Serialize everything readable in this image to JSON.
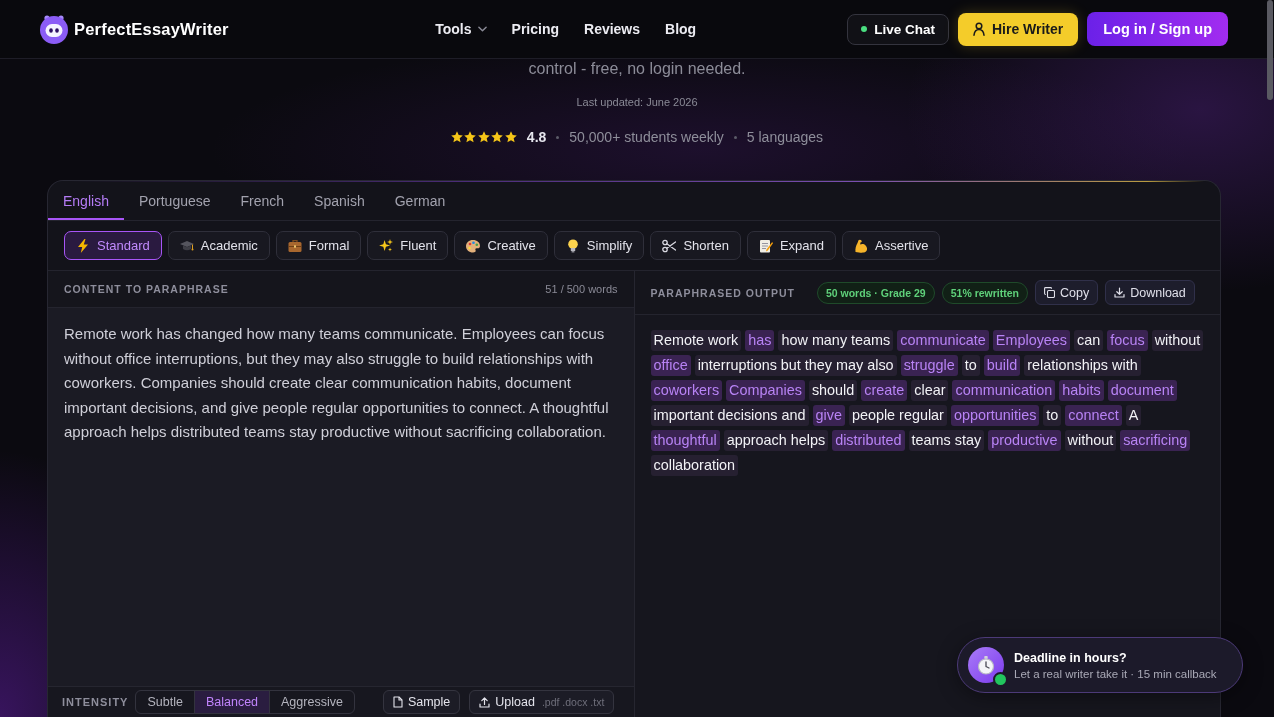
{
  "header": {
    "logo": "PerfectEssayWriter",
    "nav": [
      {
        "label": "Tools",
        "dropdown": true
      },
      {
        "label": "Pricing",
        "dropdown": false
      },
      {
        "label": "Reviews",
        "dropdown": false
      },
      {
        "label": "Blog",
        "dropdown": false
      }
    ],
    "live_chat": {
      "label": "Live Chat",
      "online": true
    },
    "hire_button": "Hire Writer",
    "login_button": "Log in / Sign up"
  },
  "hero": {
    "subtitle": "control - free, no login needed.",
    "updated": "Last updated: June 2026",
    "rating": {
      "stars": 5,
      "score": "4.8"
    },
    "facts": [
      "50,000+ students weekly",
      "5 languages"
    ]
  },
  "tool": {
    "languages": [
      {
        "label": "English",
        "selected": true
      },
      {
        "label": "Portuguese",
        "selected": false
      },
      {
        "label": "French",
        "selected": false
      },
      {
        "label": "Spanish",
        "selected": false
      },
      {
        "label": "German",
        "selected": false
      }
    ],
    "modes": [
      {
        "label": "Standard",
        "selected": true
      },
      {
        "label": "Academic",
        "selected": false
      },
      {
        "label": "Formal",
        "selected": false
      },
      {
        "label": "Fluent",
        "selected": false
      },
      {
        "label": "Creative",
        "selected": false
      },
      {
        "label": "Simplify",
        "selected": false
      },
      {
        "label": "Shorten",
        "selected": false
      },
      {
        "label": "Expand",
        "selected": false
      },
      {
        "label": "Assertive",
        "selected": false
      }
    ],
    "input": {
      "title": "CONTENT TO PARAPHRASE",
      "count": "51 / 500 words",
      "value": "Remote work has changed how many teams communicate. Employees can focus without office interruptions, but they may also struggle to build relationships with coworkers. Companies should create clear communication habits, document important decisions, and give people regular opportunities to connect. A thoughtful approach helps distributed teams stay productive without sacrificing collaboration."
    },
    "intensity": {
      "label": "INTENSITY",
      "options": [
        {
          "label": "Subtle",
          "selected": false
        },
        {
          "label": "Balanced",
          "selected": true
        },
        {
          "label": "Aggressive",
          "selected": false
        }
      ]
    },
    "actions": {
      "sample": "Sample",
      "upload": "Upload",
      "upload_hint": ".pdf .docx .txt"
    },
    "output": {
      "title": "PARAPHRASED OUTPUT",
      "badges": [
        "50 words · Grade 29",
        "51% rewritten"
      ],
      "copy": "Copy",
      "download": "Download",
      "segments": [
        {
          "text": "Remote work",
          "changed": false
        },
        {
          "text": "has",
          "changed": true
        },
        {
          "text": "how many teams",
          "changed": false
        },
        {
          "text": "communicate",
          "changed": true
        },
        {
          "text": "Employees",
          "changed": true
        },
        {
          "text": "can",
          "changed": false
        },
        {
          "text": "focus",
          "changed": true
        },
        {
          "text": "without",
          "changed": false
        },
        {
          "text": "office",
          "changed": true
        },
        {
          "text": "interruptions but they may also",
          "changed": false
        },
        {
          "text": "struggle",
          "changed": true
        },
        {
          "text": "to",
          "changed": false
        },
        {
          "text": "build",
          "changed": true
        },
        {
          "text": "relationships with",
          "changed": false
        },
        {
          "text": "coworkers",
          "changed": true
        },
        {
          "text": "Companies",
          "changed": true
        },
        {
          "text": "should",
          "changed": false
        },
        {
          "text": "create",
          "changed": true
        },
        {
          "text": "clear",
          "changed": false
        },
        {
          "text": "communication",
          "changed": true
        },
        {
          "text": "habits",
          "changed": true
        },
        {
          "text": "document",
          "changed": true
        },
        {
          "text": "important decisions and",
          "changed": false
        },
        {
          "text": "give",
          "changed": true
        },
        {
          "text": "people regular",
          "changed": false
        },
        {
          "text": "opportunities",
          "changed": true
        },
        {
          "text": "to",
          "changed": false
        },
        {
          "text": "connect",
          "changed": true
        },
        {
          "text": "A",
          "changed": false
        },
        {
          "text": "thoughtful",
          "changed": true
        },
        {
          "text": "approach helps",
          "changed": false
        },
        {
          "text": "distributed",
          "changed": true
        },
        {
          "text": "teams stay",
          "changed": false
        },
        {
          "text": "productive",
          "changed": true
        },
        {
          "text": "without",
          "changed": false
        },
        {
          "text": "sacrificing",
          "changed": true
        },
        {
          "text": "collaboration",
          "changed": false
        }
      ]
    }
  },
  "callback_popup": {
    "title": "Deadline in hours?",
    "subtitle": "Let a real writer take it · 15 min callback",
    "online": true
  }
}
